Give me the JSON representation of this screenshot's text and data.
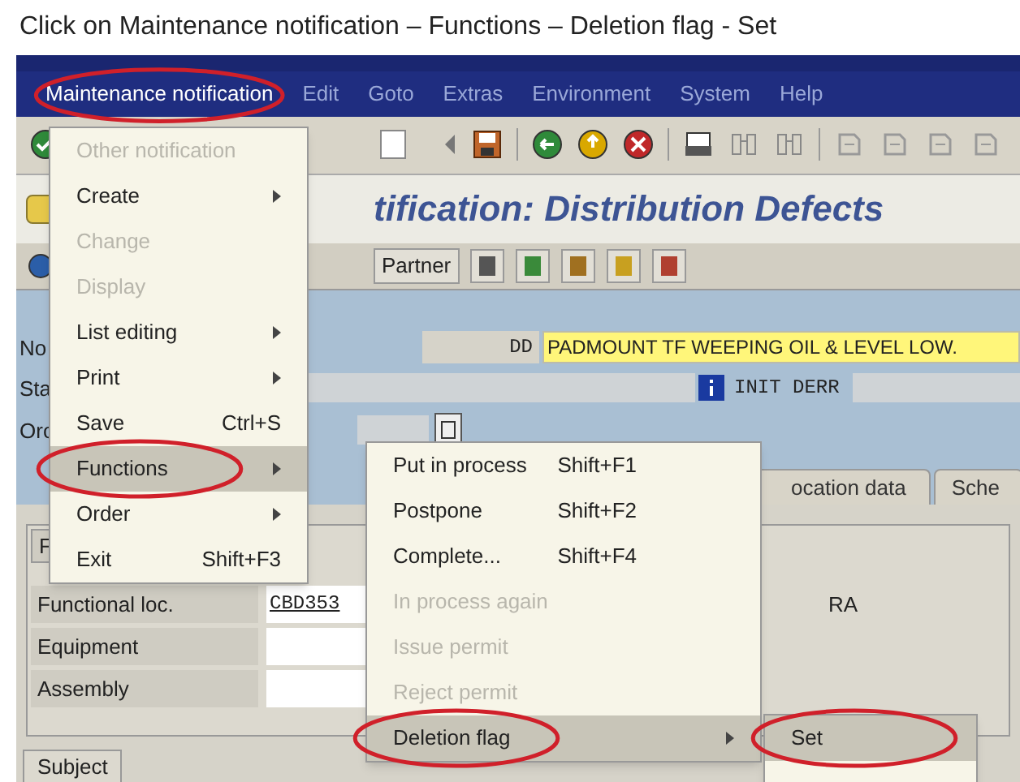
{
  "caption": "Click on Maintenance notification – Functions  – Deletion flag - Set",
  "menu_bar": [
    {
      "label": "Maintenance notification",
      "selected": true,
      "circled": true
    },
    {
      "label": "Edit",
      "selected": false,
      "circled": false
    },
    {
      "label": "Goto",
      "selected": false,
      "circled": false
    },
    {
      "label": "Extras",
      "selected": false,
      "circled": false
    },
    {
      "label": "Environment",
      "selected": false,
      "circled": false
    },
    {
      "label": "System",
      "selected": false,
      "circled": false
    },
    {
      "label": "Help",
      "selected": false,
      "circled": false
    }
  ],
  "title": "tification: Distribution Defects",
  "app_toolbar": {
    "button": "Partner"
  },
  "header": {
    "labels": [
      "No",
      "Sta",
      "Orc"
    ],
    "type_code": "DD",
    "description": "PADMOUNT TF WEEPING OIL  & LEVEL LOW.",
    "status": "INIT DERR"
  },
  "tabs": [
    {
      "label": "ocation data",
      "selected": false
    },
    {
      "label": "Sche",
      "selected": false
    }
  ],
  "frame": {
    "label": "F",
    "fields": [
      {
        "label": "Functional loc.",
        "value": "CBD353",
        "note": "RA"
      },
      {
        "label": "Equipment"
      },
      {
        "label": "Assembly"
      }
    ]
  },
  "bottom_tabs": [
    {
      "label": "Subject",
      "selected": true
    }
  ],
  "menu": [
    {
      "label": "Other notification",
      "disabled": true,
      "submenu": false,
      "selected": false,
      "circled": false
    },
    {
      "label": "Create",
      "disabled": false,
      "submenu": true,
      "selected": false,
      "circled": false
    },
    {
      "label": "Change",
      "disabled": true,
      "submenu": false,
      "selected": false,
      "circled": false
    },
    {
      "label": "Display",
      "disabled": true,
      "submenu": false,
      "selected": false,
      "circled": false
    },
    {
      "label": "List editing",
      "disabled": false,
      "submenu": true,
      "selected": false,
      "circled": false
    },
    {
      "label": "Print",
      "disabled": false,
      "submenu": true,
      "selected": false,
      "circled": false
    },
    {
      "label": "Save",
      "shortcut": "Ctrl+S",
      "disabled": false,
      "submenu": false,
      "selected": false,
      "circled": false
    },
    {
      "label": "Functions",
      "disabled": false,
      "submenu": true,
      "selected": true,
      "circled": true
    },
    {
      "label": "Order",
      "disabled": false,
      "submenu": true,
      "selected": false,
      "circled": false
    },
    {
      "label": "Exit",
      "shortcut": "Shift+F3",
      "disabled": false,
      "submenu": false,
      "selected": false,
      "circled": false
    }
  ],
  "submenu": [
    {
      "label": "Put in process",
      "shortcut": "Shift+F1",
      "disabled": false,
      "submenu": false,
      "selected": false,
      "circled": false
    },
    {
      "label": "Postpone",
      "shortcut": "Shift+F2",
      "disabled": false,
      "submenu": false,
      "selected": false,
      "circled": false
    },
    {
      "label": "Complete...",
      "shortcut": "Shift+F4",
      "disabled": false,
      "submenu": false,
      "selected": false,
      "circled": false
    },
    {
      "label": "In process again",
      "disabled": true,
      "submenu": false,
      "selected": false,
      "circled": false
    },
    {
      "label": "Issue permit",
      "disabled": true,
      "submenu": false,
      "selected": false,
      "circled": false
    },
    {
      "label": "Reject permit",
      "disabled": true,
      "submenu": false,
      "selected": false,
      "circled": false
    },
    {
      "label": "Deletion flag",
      "disabled": false,
      "submenu": true,
      "selected": true,
      "circled": true
    }
  ],
  "subsubmenu": [
    {
      "label": "Set",
      "disabled": false,
      "submenu": false,
      "selected": true,
      "circled": true
    }
  ]
}
